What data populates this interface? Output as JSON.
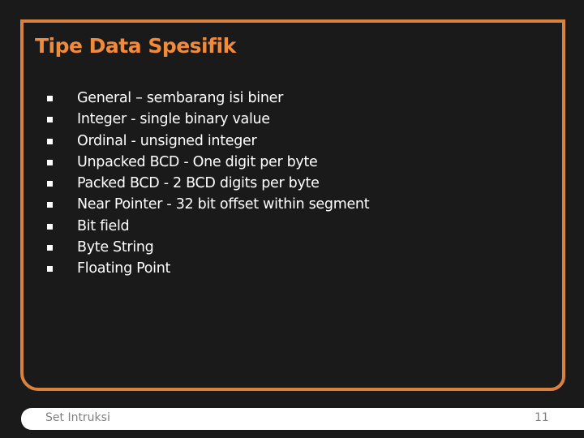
{
  "slide": {
    "title": "Tipe Data Spesifik",
    "bullets": [
      "General – sembarang isi biner",
      "Integer - single binary value",
      "Ordinal - unsigned integer",
      "Unpacked BCD - One digit per byte",
      "Packed BCD - 2 BCD digits per byte",
      "Near Pointer - 32 bit offset within segment",
      "Bit field",
      "Byte String",
      "Floating Point"
    ],
    "bullet_icon": "square-bullet"
  },
  "footer": {
    "title": "Set Intruksi",
    "page_number": "11"
  },
  "colors": {
    "background": "#1a1a1a",
    "accent": "#d9813f",
    "title": "#f08a3c",
    "text": "#ffffff",
    "footer_bar": "#ffffff",
    "footer_text": "#7f7f7f"
  }
}
